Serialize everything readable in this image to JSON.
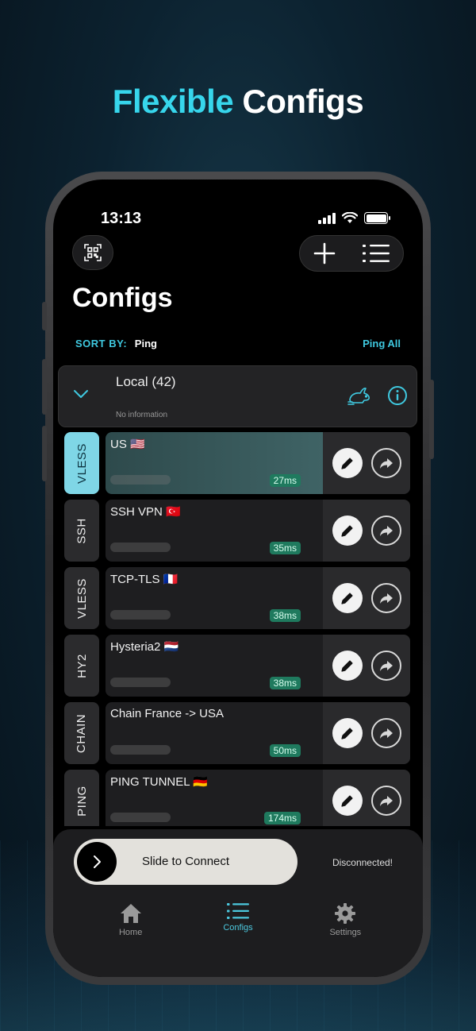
{
  "headline": {
    "accent": "Flexible",
    "rest": "Configs"
  },
  "status": {
    "time": "13:13"
  },
  "page": {
    "title": "Configs",
    "sort_label": "SORT BY:",
    "sort_value": "Ping",
    "ping_all": "Ping All"
  },
  "group": {
    "title": "Local (42)",
    "subtitle": "No information"
  },
  "configs": [
    {
      "protocol": "VLESS",
      "name": "US 🇺🇸",
      "ping": "27ms"
    },
    {
      "protocol": "SSH",
      "name": "SSH VPN 🇹🇷",
      "ping": "35ms"
    },
    {
      "protocol": "VLESS",
      "name": "TCP-TLS 🇫🇷",
      "ping": "38ms"
    },
    {
      "protocol": "HY2",
      "name": "Hysteria2 🇳🇱",
      "ping": "38ms"
    },
    {
      "protocol": "CHAIN",
      "name": "Chain France -> USA",
      "ping": "50ms"
    },
    {
      "protocol": "PING",
      "name": "PING TUNNEL 🇩🇪",
      "ping": "174ms"
    }
  ],
  "connect": {
    "slider_label": "Slide to Connect",
    "status": "Disconnected!"
  },
  "tabs": [
    {
      "label": "Home",
      "icon": "home-icon"
    },
    {
      "label": "Configs",
      "icon": "list-icon"
    },
    {
      "label": "Settings",
      "icon": "gear-icon"
    }
  ],
  "colors": {
    "accent": "#37d6ec",
    "active_tag": "#7fd6e6",
    "ping_badge": "#1f7a5e"
  }
}
